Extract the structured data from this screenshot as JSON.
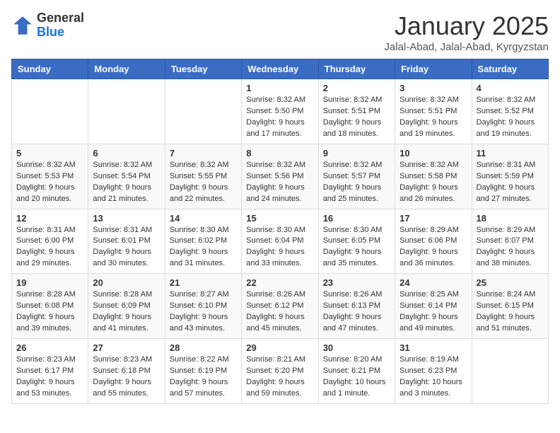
{
  "header": {
    "logo_general": "General",
    "logo_blue": "Blue",
    "month": "January 2025",
    "location": "Jalal-Abad, Jalal-Abad, Kyrgyzstan"
  },
  "days_of_week": [
    "Sunday",
    "Monday",
    "Tuesday",
    "Wednesday",
    "Thursday",
    "Friday",
    "Saturday"
  ],
  "weeks": [
    [
      {
        "day": "",
        "info": ""
      },
      {
        "day": "",
        "info": ""
      },
      {
        "day": "",
        "info": ""
      },
      {
        "day": "1",
        "info": "Sunrise: 8:32 AM\nSunset: 5:50 PM\nDaylight: 9 hours\nand 17 minutes."
      },
      {
        "day": "2",
        "info": "Sunrise: 8:32 AM\nSunset: 5:51 PM\nDaylight: 9 hours\nand 18 minutes."
      },
      {
        "day": "3",
        "info": "Sunrise: 8:32 AM\nSunset: 5:51 PM\nDaylight: 9 hours\nand 19 minutes."
      },
      {
        "day": "4",
        "info": "Sunrise: 8:32 AM\nSunset: 5:52 PM\nDaylight: 9 hours\nand 19 minutes."
      }
    ],
    [
      {
        "day": "5",
        "info": "Sunrise: 8:32 AM\nSunset: 5:53 PM\nDaylight: 9 hours\nand 20 minutes."
      },
      {
        "day": "6",
        "info": "Sunrise: 8:32 AM\nSunset: 5:54 PM\nDaylight: 9 hours\nand 21 minutes."
      },
      {
        "day": "7",
        "info": "Sunrise: 8:32 AM\nSunset: 5:55 PM\nDaylight: 9 hours\nand 22 minutes."
      },
      {
        "day": "8",
        "info": "Sunrise: 8:32 AM\nSunset: 5:56 PM\nDaylight: 9 hours\nand 24 minutes."
      },
      {
        "day": "9",
        "info": "Sunrise: 8:32 AM\nSunset: 5:57 PM\nDaylight: 9 hours\nand 25 minutes."
      },
      {
        "day": "10",
        "info": "Sunrise: 8:32 AM\nSunset: 5:58 PM\nDaylight: 9 hours\nand 26 minutes."
      },
      {
        "day": "11",
        "info": "Sunrise: 8:31 AM\nSunset: 5:59 PM\nDaylight: 9 hours\nand 27 minutes."
      }
    ],
    [
      {
        "day": "12",
        "info": "Sunrise: 8:31 AM\nSunset: 6:00 PM\nDaylight: 9 hours\nand 29 minutes."
      },
      {
        "day": "13",
        "info": "Sunrise: 8:31 AM\nSunset: 6:01 PM\nDaylight: 9 hours\nand 30 minutes."
      },
      {
        "day": "14",
        "info": "Sunrise: 8:30 AM\nSunset: 6:02 PM\nDaylight: 9 hours\nand 31 minutes."
      },
      {
        "day": "15",
        "info": "Sunrise: 8:30 AM\nSunset: 6:04 PM\nDaylight: 9 hours\nand 33 minutes."
      },
      {
        "day": "16",
        "info": "Sunrise: 8:30 AM\nSunset: 6:05 PM\nDaylight: 9 hours\nand 35 minutes."
      },
      {
        "day": "17",
        "info": "Sunrise: 8:29 AM\nSunset: 6:06 PM\nDaylight: 9 hours\nand 36 minutes."
      },
      {
        "day": "18",
        "info": "Sunrise: 8:29 AM\nSunset: 6:07 PM\nDaylight: 9 hours\nand 38 minutes."
      }
    ],
    [
      {
        "day": "19",
        "info": "Sunrise: 8:28 AM\nSunset: 6:08 PM\nDaylight: 9 hours\nand 39 minutes."
      },
      {
        "day": "20",
        "info": "Sunrise: 8:28 AM\nSunset: 6:09 PM\nDaylight: 9 hours\nand 41 minutes."
      },
      {
        "day": "21",
        "info": "Sunrise: 8:27 AM\nSunset: 6:10 PM\nDaylight: 9 hours\nand 43 minutes."
      },
      {
        "day": "22",
        "info": "Sunrise: 8:26 AM\nSunset: 6:12 PM\nDaylight: 9 hours\nand 45 minutes."
      },
      {
        "day": "23",
        "info": "Sunrise: 8:26 AM\nSunset: 6:13 PM\nDaylight: 9 hours\nand 47 minutes."
      },
      {
        "day": "24",
        "info": "Sunrise: 8:25 AM\nSunset: 6:14 PM\nDaylight: 9 hours\nand 49 minutes."
      },
      {
        "day": "25",
        "info": "Sunrise: 8:24 AM\nSunset: 6:15 PM\nDaylight: 9 hours\nand 51 minutes."
      }
    ],
    [
      {
        "day": "26",
        "info": "Sunrise: 8:23 AM\nSunset: 6:17 PM\nDaylight: 9 hours\nand 53 minutes."
      },
      {
        "day": "27",
        "info": "Sunrise: 8:23 AM\nSunset: 6:18 PM\nDaylight: 9 hours\nand 55 minutes."
      },
      {
        "day": "28",
        "info": "Sunrise: 8:22 AM\nSunset: 6:19 PM\nDaylight: 9 hours\nand 57 minutes."
      },
      {
        "day": "29",
        "info": "Sunrise: 8:21 AM\nSunset: 6:20 PM\nDaylight: 9 hours\nand 59 minutes."
      },
      {
        "day": "30",
        "info": "Sunrise: 8:20 AM\nSunset: 6:21 PM\nDaylight: 10 hours\nand 1 minute."
      },
      {
        "day": "31",
        "info": "Sunrise: 8:19 AM\nSunset: 6:23 PM\nDaylight: 10 hours\nand 3 minutes."
      },
      {
        "day": "",
        "info": ""
      }
    ]
  ]
}
